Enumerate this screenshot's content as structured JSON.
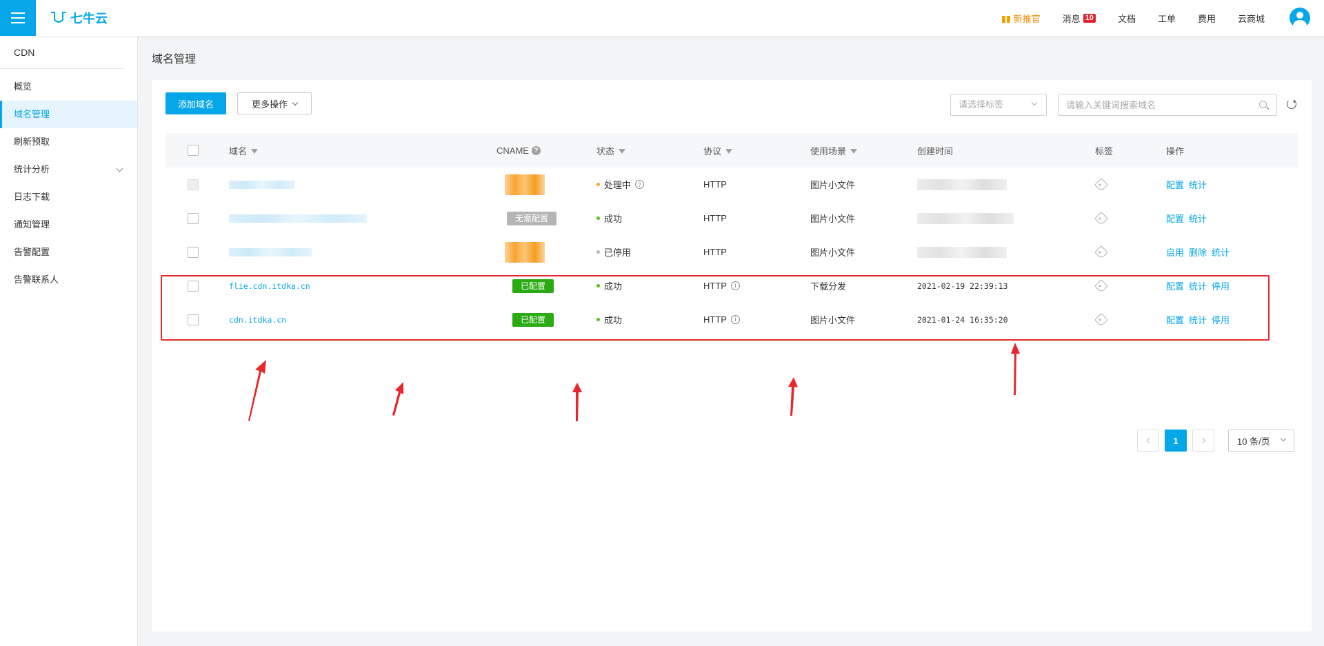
{
  "topbar": {
    "logo_text": "七牛云",
    "nav": [
      {
        "label": "新推官",
        "promo": true
      },
      {
        "label": "消息",
        "badge": "10"
      },
      {
        "label": "文档"
      },
      {
        "label": "工单"
      },
      {
        "label": "费用"
      },
      {
        "label": "云商城"
      }
    ]
  },
  "sidebar": {
    "title": "CDN",
    "items": [
      {
        "label": "概览"
      },
      {
        "label": "域名管理",
        "active": true
      },
      {
        "label": "刷新预取"
      },
      {
        "label": "统计分析",
        "expandable": true
      },
      {
        "label": "日志下载"
      },
      {
        "label": "通知管理"
      },
      {
        "label": "告警配置"
      },
      {
        "label": "告警联系人"
      }
    ]
  },
  "main": {
    "page_title": "域名管理",
    "add_button": "添加域名",
    "more_button": "更多操作",
    "tag_select_placeholder": "请选择标签",
    "search_placeholder": "请输入关键词搜索域名"
  },
  "table": {
    "headers": {
      "domain": "域名",
      "cname": "CNAME",
      "status": "状态",
      "protocol": "协议",
      "scene": "使用场景",
      "created": "创建时间",
      "tag": "标签",
      "ops": "操作"
    },
    "rows": [
      {
        "domain": "",
        "blurred": true,
        "cname": "",
        "cname_type": "orange",
        "status": "处理中",
        "status_color": "#f5a623",
        "status_help": true,
        "protocol": "HTTP",
        "protocol_info": false,
        "scene": "图片小文件",
        "created": "",
        "ops": [
          "配置",
          "统计"
        ],
        "checkbox_disabled": true
      },
      {
        "domain": "",
        "blurred": true,
        "cname": "无需配置",
        "cname_type": "gray",
        "status": "成功",
        "status_color": "#52c41a",
        "status_help": false,
        "protocol": "HTTP",
        "protocol_info": false,
        "scene": "图片小文件",
        "created": "",
        "ops": [
          "配置",
          "统计"
        ],
        "checkbox_disabled": false
      },
      {
        "domain": "",
        "blurred": true,
        "cname": "",
        "cname_type": "orange",
        "status": "已停用",
        "status_color": "#b5b5b5",
        "status_help": false,
        "protocol": "HTTP",
        "protocol_info": false,
        "scene": "图片小文件",
        "created": "",
        "ops": [
          "启用",
          "删除",
          "统计"
        ],
        "checkbox_disabled": false
      },
      {
        "domain": "flie.cdn.itdka.cn",
        "blurred": false,
        "cname": "已配置",
        "cname_type": "green",
        "status": "成功",
        "status_color": "#52c41a",
        "status_help": false,
        "protocol": "HTTP",
        "protocol_info": true,
        "scene": "下载分发",
        "created": "2021-02-19 22:39:13",
        "ops": [
          "配置",
          "统计",
          "停用"
        ],
        "checkbox_disabled": false
      },
      {
        "domain": "cdn.itdka.cn",
        "blurred": false,
        "cname": "已配置",
        "cname_type": "green",
        "status": "成功",
        "status_color": "#52c41a",
        "status_help": false,
        "protocol": "HTTP",
        "protocol_info": true,
        "scene": "图片小文件",
        "created": "2021-01-24 16:35:20",
        "ops": [
          "配置",
          "统计",
          "停用"
        ],
        "checkbox_disabled": false
      }
    ]
  },
  "pagination": {
    "current": "1",
    "page_size": "10 条/页"
  },
  "colors": {
    "accent": "#06a7e8",
    "annotation": "#e8262c",
    "success_pill": "#2aab14"
  }
}
